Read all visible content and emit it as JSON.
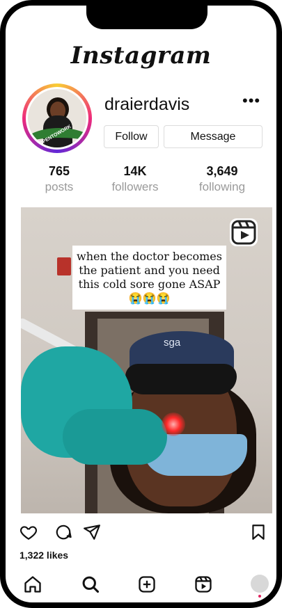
{
  "app": {
    "brand": "Instagram"
  },
  "profile": {
    "username": "draierdavis",
    "avatar_badge": "#OPENTOWORK",
    "more_label": "•••",
    "follow_label": "Follow",
    "message_label": "Message",
    "stats": [
      {
        "value": "765",
        "label": "posts"
      },
      {
        "value": "14K",
        "label": "followers"
      },
      {
        "value": "3,649",
        "label": "following"
      }
    ]
  },
  "post": {
    "caption_line1": "when the doctor becomes",
    "caption_line2": "the patient and you need",
    "caption_line3": "this cold sore gone ASAP",
    "caption_emoji": "😭😭😭",
    "cap_text": "sga",
    "likes": "1,322 likes"
  },
  "icons": {
    "like": "heart-icon",
    "comment": "comment-icon",
    "share": "send-icon",
    "save": "bookmark-icon",
    "reels_badge": "reels-icon",
    "nav": [
      "home-icon",
      "search-icon",
      "create-icon",
      "reels-icon",
      "profile-avatar"
    ]
  },
  "colors": {
    "ring_gradient": [
      "#f9ce34",
      "#ee2a7b",
      "#6228d7"
    ],
    "badge_green": "#2f7d32",
    "notification_dot": "#e0245e"
  }
}
